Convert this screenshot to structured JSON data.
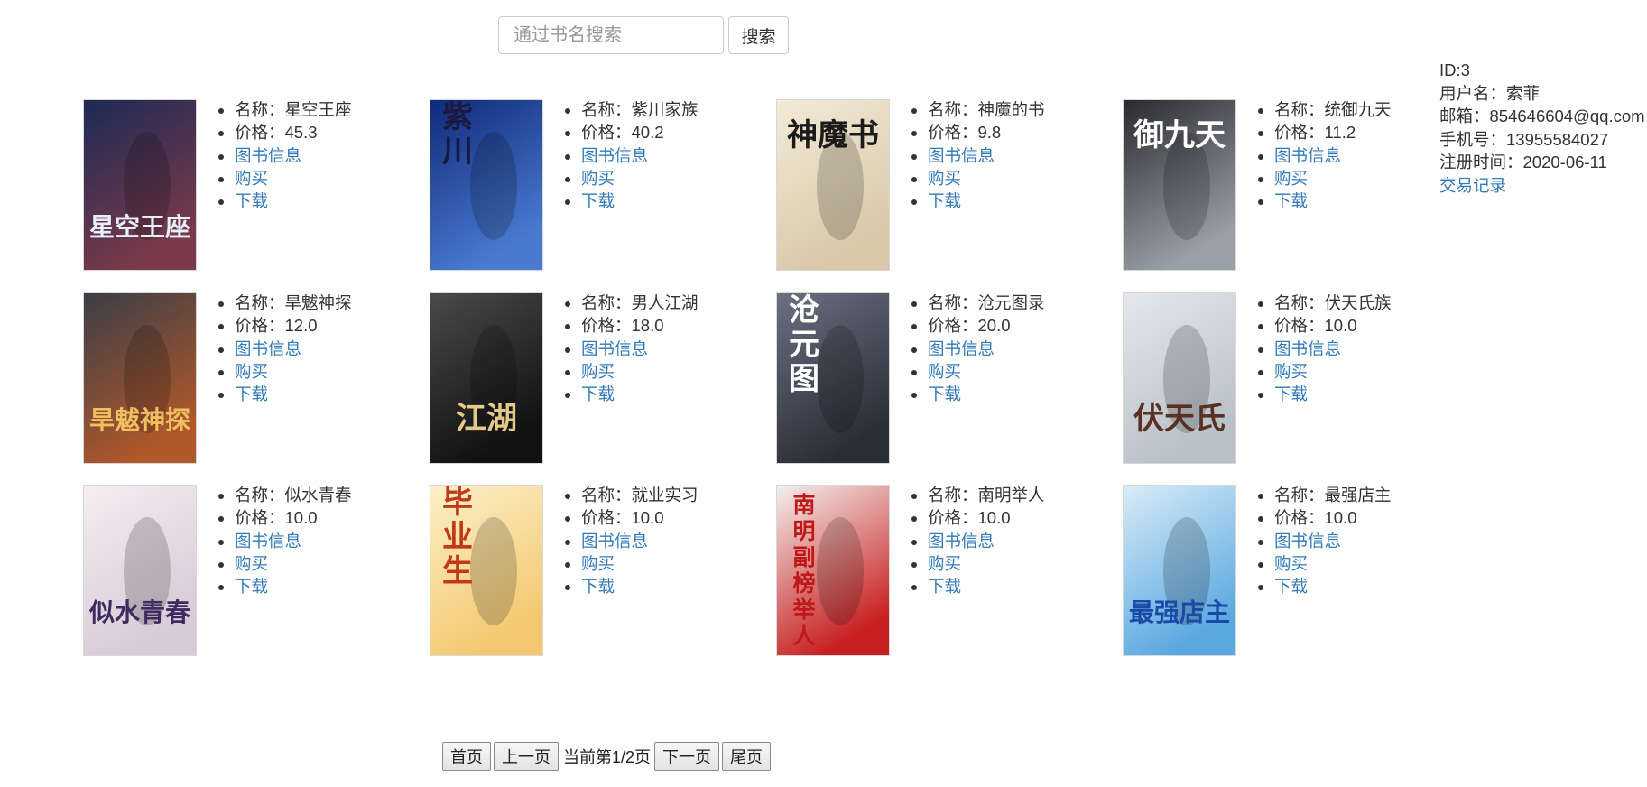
{
  "search": {
    "placeholder": "通过书名搜索",
    "button_label": "搜索"
  },
  "user": {
    "id": "ID:3",
    "username": "用户名：索菲",
    "email": "邮箱：854646604@qq.com",
    "phone": "手机号：13955584027",
    "register_time": "注册时间：2020-06-11",
    "transactions_link": "交易记录"
  },
  "books": [
    {
      "name": "名称：星空王座",
      "price": "价格：45.3",
      "info_link": "图书信息",
      "buy_link": "购买",
      "download_link": "下载",
      "cover": {
        "title": "星空王座",
        "colors": [
          "#1d2a55",
          "#7a3a4a"
        ],
        "text_color": "#e8eefc",
        "vertical": false
      }
    },
    {
      "name": "名称：紫川家族",
      "price": "价格：40.2",
      "info_link": "图书信息",
      "buy_link": "购买",
      "download_link": "下载",
      "cover": {
        "title": "紫川",
        "colors": [
          "#0f2a7a",
          "#4a7ad0"
        ],
        "text_color": "#1a1a40",
        "vertical": true
      }
    },
    {
      "name": "名称：神魔的书",
      "price": "价格：9.8",
      "info_link": "图书信息",
      "buy_link": "购买",
      "download_link": "下载",
      "cover": {
        "title": "神魔书",
        "colors": [
          "#f3ead8",
          "#d8c8a8"
        ],
        "text_color": "#1a1a1a",
        "vertical": false
      }
    },
    {
      "name": "名称：统御九天",
      "price": "价格：11.2",
      "info_link": "图书信息",
      "buy_link": "购买",
      "download_link": "下载",
      "cover": {
        "title": "御九天",
        "colors": [
          "#2a2a2e",
          "#9aa0a8"
        ],
        "text_color": "#ffffff",
        "vertical": false
      }
    },
    {
      "name": "名称：旱魃神探",
      "price": "价格：12.0",
      "info_link": "图书信息",
      "buy_link": "购买",
      "download_link": "下载",
      "cover": {
        "title": "旱魃神探",
        "colors": [
          "#3a3e48",
          "#b0582a"
        ],
        "text_color": "#f0c060",
        "vertical": false
      }
    },
    {
      "name": "名称：男人江湖",
      "price": "价格：18.0",
      "info_link": "图书信息",
      "buy_link": "购买",
      "download_link": "下载",
      "cover": {
        "title": "江湖",
        "colors": [
          "#4a4a4a",
          "#111111"
        ],
        "text_color": "#e6c98a",
        "vertical": false
      }
    },
    {
      "name": "名称：沧元图录",
      "price": "价格：20.0",
      "info_link": "图书信息",
      "buy_link": "购买",
      "download_link": "下载",
      "cover": {
        "title": "沧元图",
        "colors": [
          "#6a7080",
          "#2a2e38"
        ],
        "text_color": "#ffffff",
        "vertical": true
      }
    },
    {
      "name": "名称：伏天氏族",
      "price": "价格：10.0",
      "info_link": "图书信息",
      "buy_link": "购买",
      "download_link": "下载",
      "cover": {
        "title": "伏天氏",
        "colors": [
          "#e4e8ec",
          "#b8c0c8"
        ],
        "text_color": "#5a3020",
        "vertical": false
      }
    },
    {
      "name": "名称：似水青春",
      "price": "价格：10.0",
      "info_link": "图书信息",
      "buy_link": "购买",
      "download_link": "下载",
      "cover": {
        "title": "似水青春",
        "colors": [
          "#f4eef0",
          "#d8cad6"
        ],
        "text_color": "#402a60",
        "vertical": false
      }
    },
    {
      "name": "名称：就业实习",
      "price": "价格：10.0",
      "info_link": "图书信息",
      "buy_link": "购买",
      "download_link": "下载",
      "cover": {
        "title": "毕业生",
        "colors": [
          "#fbf0c8",
          "#f4c870"
        ],
        "text_color": "#c03a1a",
        "vertical": true
      }
    },
    {
      "name": "名称：南明举人",
      "price": "价格：10.0",
      "info_link": "图书信息",
      "buy_link": "购买",
      "download_link": "下载",
      "cover": {
        "title": "南明副榜举人",
        "colors": [
          "#f2f0ee",
          "#c82020"
        ],
        "text_color": "#c01818",
        "vertical": true
      }
    },
    {
      "name": "名称：最强店主",
      "price": "价格：10.0",
      "info_link": "图书信息",
      "buy_link": "购买",
      "download_link": "下载",
      "cover": {
        "title": "最强店主",
        "colors": [
          "#d8ecf8",
          "#5aa8e0"
        ],
        "text_color": "#1a4aa8",
        "vertical": false
      }
    }
  ],
  "pagination": {
    "first": "首页",
    "prev": "上一页",
    "status": "当前第1/2页",
    "next": "下一页",
    "last": "尾页"
  }
}
